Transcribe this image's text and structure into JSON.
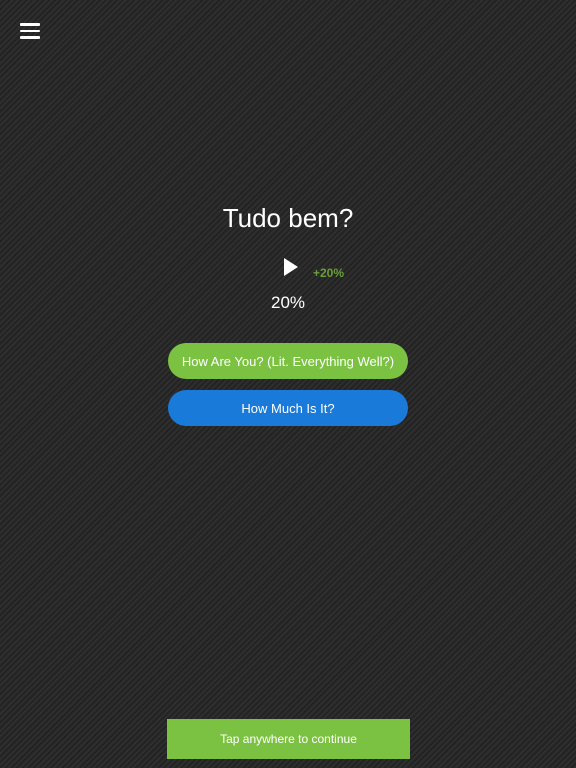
{
  "header": {
    "menu_icon": "hamburger-menu-icon"
  },
  "quiz": {
    "phrase": "Tudo bem?",
    "play_icon": "play-icon",
    "bonus": "+20%",
    "progress_label": "20%",
    "progress_value": 20,
    "answers": [
      {
        "label": "How Are You? (Lit. Everything Well?)",
        "color": "#7cc242"
      },
      {
        "label": "How Much Is It?",
        "color": "#1a7ad9"
      }
    ]
  },
  "footer": {
    "continue_label": "Tap anywhere to continue",
    "continue_color": "#7cc242"
  },
  "colors": {
    "bonus_text": "#6a9e3a",
    "background": "#2b2b2b"
  }
}
